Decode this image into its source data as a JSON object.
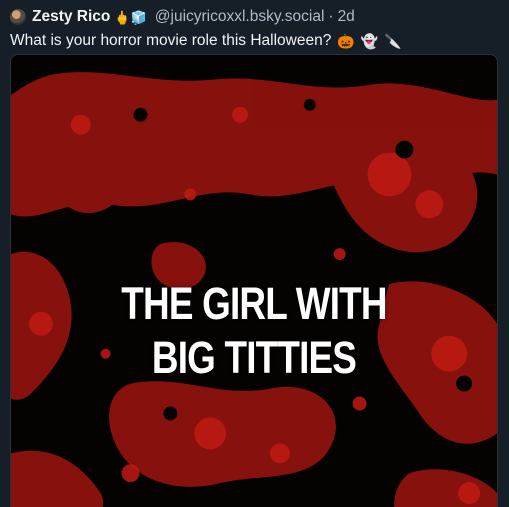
{
  "post": {
    "author": {
      "display_name": "Zesty Rico",
      "name_emojis": "🖕🧊",
      "handle": "@juicyricoxxl.bsky.social",
      "separator": "·",
      "time_ago": "2d"
    },
    "text": "What is your horror movie role this Halloween?",
    "text_emojis": [
      "🎃",
      "👻",
      "🔪"
    ],
    "image": {
      "lines": [
        "THE GIRL WITH",
        "BIG TITTIES"
      ],
      "background_color": "#050202",
      "splatter_color": "#a3150f"
    }
  }
}
